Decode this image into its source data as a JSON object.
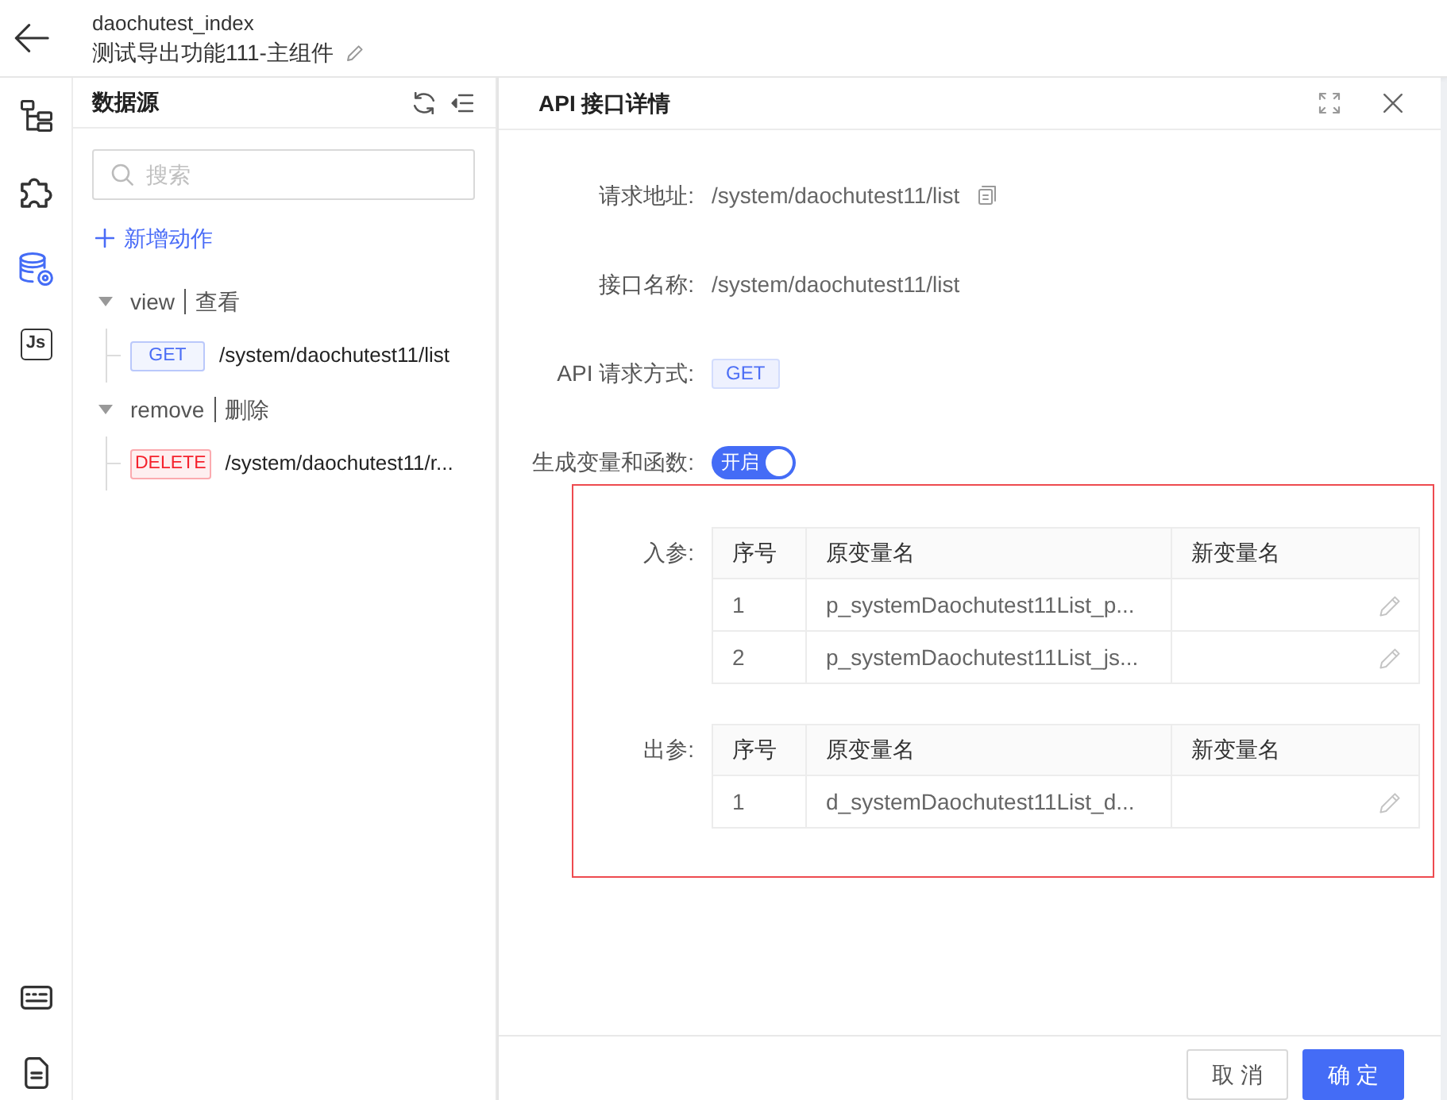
{
  "header": {
    "title": "daochutest_index",
    "subtitle": "测试导出功能111-主组件"
  },
  "rail": [
    {
      "selected": false
    },
    {
      "selected": false
    },
    {
      "selected": true
    },
    {
      "selected": false,
      "glyph": "Js"
    }
  ],
  "datasource": {
    "title": "数据源",
    "search": {
      "placeholder": "搜索"
    },
    "add_action": "新增动作",
    "tree": [
      {
        "name": "view",
        "label": "查看",
        "expanded": true,
        "children": [
          {
            "method": "GET",
            "color": "#4c6ef5",
            "path": "/system/daochutest11/list"
          }
        ]
      },
      {
        "name": "remove",
        "label": "删除",
        "expanded": true,
        "children": [
          {
            "method": "DELETE",
            "color": "#f5222d",
            "path": "/system/daochutest11/r..."
          }
        ]
      }
    ]
  },
  "detail": {
    "title": "API 接口详情",
    "fields": [
      {
        "kind": "text",
        "label": "请求地址:",
        "value": "/system/daochutest11/list",
        "copyable": true
      },
      {
        "kind": "text",
        "label": "接口名称:",
        "value": "/system/daochutest11/list",
        "copyable": false
      },
      {
        "kind": "badge",
        "label": "API 请求方式:",
        "value": "GET"
      },
      {
        "kind": "switch",
        "label": "生成变量和函数:",
        "on": true,
        "text": "开启"
      }
    ],
    "params": [
      {
        "label": "入参:",
        "columns": [
          "序号",
          "原变量名",
          "新变量名"
        ],
        "rows": [
          {
            "index": "1",
            "original": "p_systemDaochutest11List_p..."
          },
          {
            "index": "2",
            "original": "p_systemDaochutest11List_js..."
          }
        ]
      },
      {
        "label": "出参:",
        "columns": [
          "序号",
          "原变量名",
          "新变量名"
        ],
        "rows": [
          {
            "index": "1",
            "original": "d_systemDaochutest11List_d..."
          }
        ]
      }
    ],
    "buttons": [
      {
        "kind": "default",
        "label": "取 消"
      },
      {
        "kind": "primary",
        "label": "确 定"
      }
    ]
  }
}
